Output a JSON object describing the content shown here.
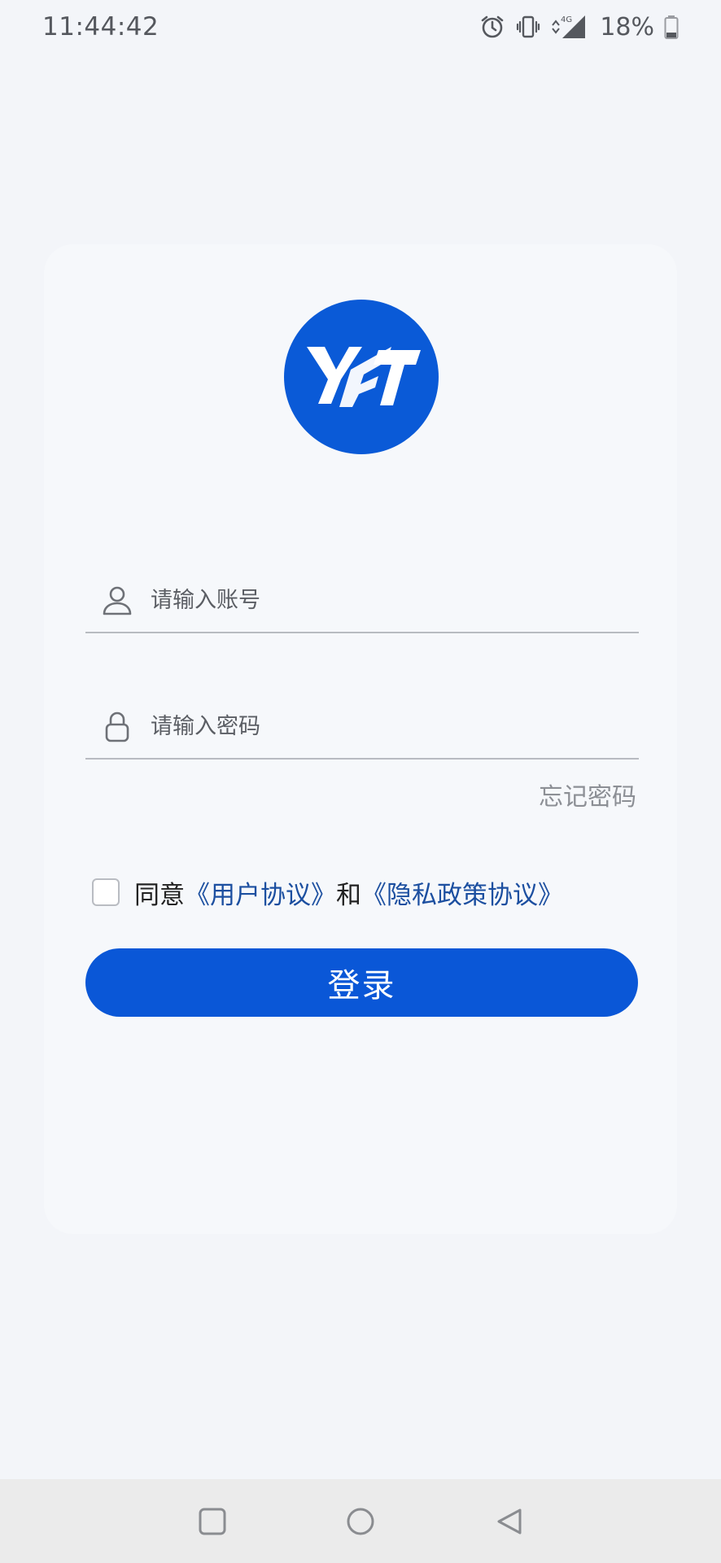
{
  "status_bar": {
    "time": "11:44:42",
    "network": "4G",
    "battery": "18%"
  },
  "logo": {
    "text": "YFT",
    "color": "#0a5ad7"
  },
  "form": {
    "account_placeholder": "请输入账号",
    "password_placeholder": "请输入密码",
    "forgot_label": "忘记密码",
    "agree_prefix": "同意",
    "user_agreement": "《用户协议》",
    "agree_and": "和",
    "privacy_policy": "《隐私政策协议》",
    "login_label": "登录"
  },
  "colors": {
    "primary": "#0a57d7",
    "link": "#1c4fa0",
    "background": "#f3f5f9"
  },
  "nav": {
    "icons": [
      "recent-apps-icon",
      "home-icon",
      "back-icon"
    ]
  }
}
